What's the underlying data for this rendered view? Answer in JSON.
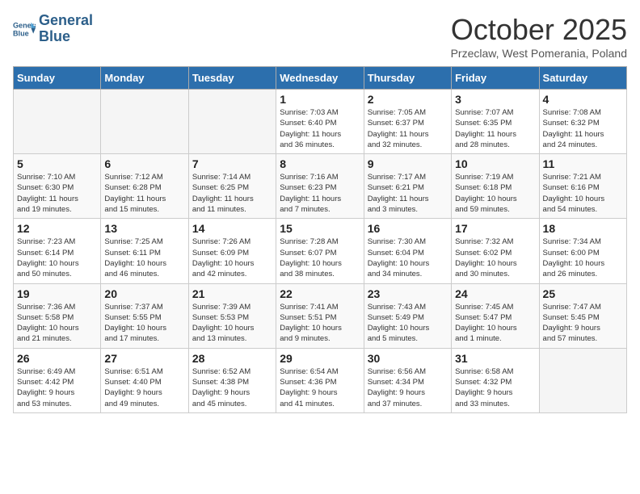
{
  "header": {
    "logo_line1": "General",
    "logo_line2": "Blue",
    "month_year": "October 2025",
    "location": "Przeclaw, West Pomerania, Poland"
  },
  "days_of_week": [
    "Sunday",
    "Monday",
    "Tuesday",
    "Wednesday",
    "Thursday",
    "Friday",
    "Saturday"
  ],
  "weeks": [
    [
      {
        "day": "",
        "info": ""
      },
      {
        "day": "",
        "info": ""
      },
      {
        "day": "",
        "info": ""
      },
      {
        "day": "1",
        "info": "Sunrise: 7:03 AM\nSunset: 6:40 PM\nDaylight: 11 hours\nand 36 minutes."
      },
      {
        "day": "2",
        "info": "Sunrise: 7:05 AM\nSunset: 6:37 PM\nDaylight: 11 hours\nand 32 minutes."
      },
      {
        "day": "3",
        "info": "Sunrise: 7:07 AM\nSunset: 6:35 PM\nDaylight: 11 hours\nand 28 minutes."
      },
      {
        "day": "4",
        "info": "Sunrise: 7:08 AM\nSunset: 6:32 PM\nDaylight: 11 hours\nand 24 minutes."
      }
    ],
    [
      {
        "day": "5",
        "info": "Sunrise: 7:10 AM\nSunset: 6:30 PM\nDaylight: 11 hours\nand 19 minutes."
      },
      {
        "day": "6",
        "info": "Sunrise: 7:12 AM\nSunset: 6:28 PM\nDaylight: 11 hours\nand 15 minutes."
      },
      {
        "day": "7",
        "info": "Sunrise: 7:14 AM\nSunset: 6:25 PM\nDaylight: 11 hours\nand 11 minutes."
      },
      {
        "day": "8",
        "info": "Sunrise: 7:16 AM\nSunset: 6:23 PM\nDaylight: 11 hours\nand 7 minutes."
      },
      {
        "day": "9",
        "info": "Sunrise: 7:17 AM\nSunset: 6:21 PM\nDaylight: 11 hours\nand 3 minutes."
      },
      {
        "day": "10",
        "info": "Sunrise: 7:19 AM\nSunset: 6:18 PM\nDaylight: 10 hours\nand 59 minutes."
      },
      {
        "day": "11",
        "info": "Sunrise: 7:21 AM\nSunset: 6:16 PM\nDaylight: 10 hours\nand 54 minutes."
      }
    ],
    [
      {
        "day": "12",
        "info": "Sunrise: 7:23 AM\nSunset: 6:14 PM\nDaylight: 10 hours\nand 50 minutes."
      },
      {
        "day": "13",
        "info": "Sunrise: 7:25 AM\nSunset: 6:11 PM\nDaylight: 10 hours\nand 46 minutes."
      },
      {
        "day": "14",
        "info": "Sunrise: 7:26 AM\nSunset: 6:09 PM\nDaylight: 10 hours\nand 42 minutes."
      },
      {
        "day": "15",
        "info": "Sunrise: 7:28 AM\nSunset: 6:07 PM\nDaylight: 10 hours\nand 38 minutes."
      },
      {
        "day": "16",
        "info": "Sunrise: 7:30 AM\nSunset: 6:04 PM\nDaylight: 10 hours\nand 34 minutes."
      },
      {
        "day": "17",
        "info": "Sunrise: 7:32 AM\nSunset: 6:02 PM\nDaylight: 10 hours\nand 30 minutes."
      },
      {
        "day": "18",
        "info": "Sunrise: 7:34 AM\nSunset: 6:00 PM\nDaylight: 10 hours\nand 26 minutes."
      }
    ],
    [
      {
        "day": "19",
        "info": "Sunrise: 7:36 AM\nSunset: 5:58 PM\nDaylight: 10 hours\nand 21 minutes."
      },
      {
        "day": "20",
        "info": "Sunrise: 7:37 AM\nSunset: 5:55 PM\nDaylight: 10 hours\nand 17 minutes."
      },
      {
        "day": "21",
        "info": "Sunrise: 7:39 AM\nSunset: 5:53 PM\nDaylight: 10 hours\nand 13 minutes."
      },
      {
        "day": "22",
        "info": "Sunrise: 7:41 AM\nSunset: 5:51 PM\nDaylight: 10 hours\nand 9 minutes."
      },
      {
        "day": "23",
        "info": "Sunrise: 7:43 AM\nSunset: 5:49 PM\nDaylight: 10 hours\nand 5 minutes."
      },
      {
        "day": "24",
        "info": "Sunrise: 7:45 AM\nSunset: 5:47 PM\nDaylight: 10 hours\nand 1 minute."
      },
      {
        "day": "25",
        "info": "Sunrise: 7:47 AM\nSunset: 5:45 PM\nDaylight: 9 hours\nand 57 minutes."
      }
    ],
    [
      {
        "day": "26",
        "info": "Sunrise: 6:49 AM\nSunset: 4:42 PM\nDaylight: 9 hours\nand 53 minutes."
      },
      {
        "day": "27",
        "info": "Sunrise: 6:51 AM\nSunset: 4:40 PM\nDaylight: 9 hours\nand 49 minutes."
      },
      {
        "day": "28",
        "info": "Sunrise: 6:52 AM\nSunset: 4:38 PM\nDaylight: 9 hours\nand 45 minutes."
      },
      {
        "day": "29",
        "info": "Sunrise: 6:54 AM\nSunset: 4:36 PM\nDaylight: 9 hours\nand 41 minutes."
      },
      {
        "day": "30",
        "info": "Sunrise: 6:56 AM\nSunset: 4:34 PM\nDaylight: 9 hours\nand 37 minutes."
      },
      {
        "day": "31",
        "info": "Sunrise: 6:58 AM\nSunset: 4:32 PM\nDaylight: 9 hours\nand 33 minutes."
      },
      {
        "day": "",
        "info": ""
      }
    ]
  ]
}
